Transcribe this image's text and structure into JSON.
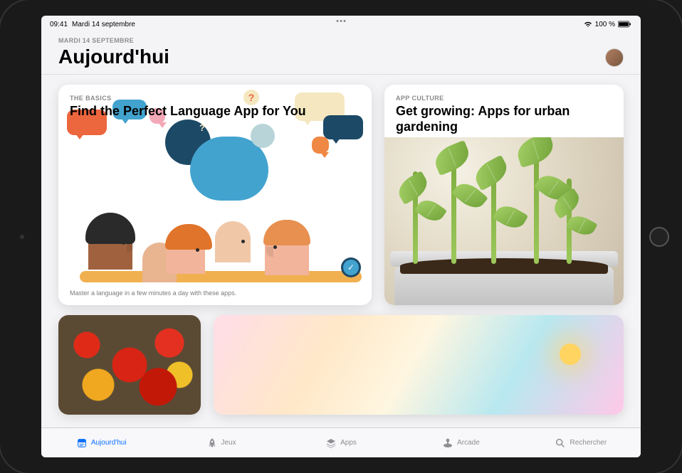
{
  "status": {
    "time": "09:41",
    "date": "Mardi 14 septembre",
    "battery_text": "100 %"
  },
  "header": {
    "date_line": "MARDI 14 SEPTEMBRE",
    "title": "Aujourd'hui"
  },
  "cards": [
    {
      "eyebrow": "THE BASICS",
      "title": "Find the Perfect Language App for You",
      "caption": "Master a language in a few minutes a day with these apps."
    },
    {
      "eyebrow": "APP CULTURE",
      "title": "Get growing: Apps for urban gardening"
    }
  ],
  "tabs": [
    {
      "id": "today",
      "label": "Aujourd'hui",
      "icon": "today-icon",
      "active": true
    },
    {
      "id": "games",
      "label": "Jeux",
      "icon": "rocket-icon",
      "active": false
    },
    {
      "id": "apps",
      "label": "Apps",
      "icon": "stack-icon",
      "active": false
    },
    {
      "id": "arcade",
      "label": "Arcade",
      "icon": "arcade-icon",
      "active": false
    },
    {
      "id": "search",
      "label": "Rechercher",
      "icon": "search-icon",
      "active": false
    }
  ]
}
